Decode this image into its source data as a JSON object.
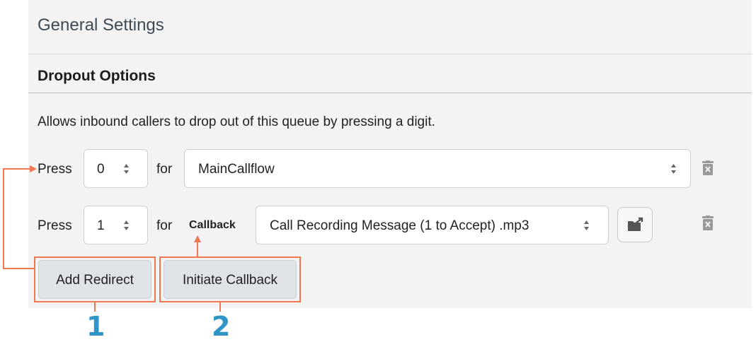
{
  "header": {
    "title": "General Settings"
  },
  "section": {
    "title": "Dropout Options",
    "description": "Allows inbound callers to drop out of this queue by pressing a digit."
  },
  "rows": [
    {
      "press_label": "Press",
      "digit": "0",
      "for_label": "for",
      "target_value": "MainCallflow"
    },
    {
      "press_label": "Press",
      "digit": "1",
      "for_label": "for",
      "type_label": "Callback",
      "target_value": "Call Recording Message (1 to Accept) .mp3"
    }
  ],
  "buttons": {
    "add_redirect": "Add Redirect",
    "initiate_callback": "Initiate Callback"
  },
  "callouts": {
    "one": "1",
    "two": "2"
  },
  "colors": {
    "highlight": "#f07850",
    "callout_number": "#2f95c8",
    "button_bg": "#dfe3e8"
  },
  "icons": {
    "select_arrows": "up-down-arrows-icon",
    "trash": "trash-icon",
    "browse": "folder-upload-icon"
  }
}
